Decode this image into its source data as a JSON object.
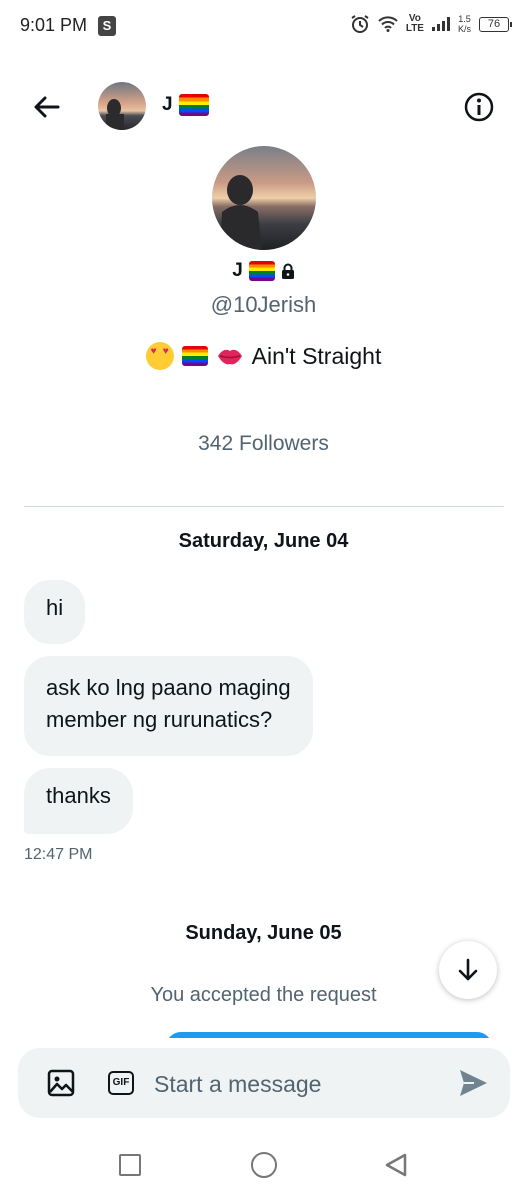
{
  "status_bar": {
    "time": "9:01 PM",
    "shop_badge": "S",
    "volte_top": "Vo",
    "volte_bottom": "LTE",
    "speed_value": "1.5",
    "speed_unit": "K/s",
    "battery": "76"
  },
  "header": {
    "name": "J",
    "icons": [
      "back-arrow-icon",
      "rainbow-flag-icon",
      "info-icon"
    ]
  },
  "profile": {
    "name": "J",
    "handle": "@10Jerish",
    "bio_text": "Ain't Straight",
    "bio_emojis": [
      "heart-eyes",
      "rainbow-flag",
      "kiss-lips"
    ],
    "followers": "342 Followers",
    "protected": true
  },
  "conversation": {
    "day1_label": "Saturday, June 04",
    "messages": [
      {
        "text": "hi"
      },
      {
        "text_line1": "ask ko lng paano maging",
        "text_line2": "member ng rurunatics?"
      },
      {
        "text": "thanks"
      }
    ],
    "timestamp": "12:47 PM",
    "day2_label": "Sunday, June 05",
    "system_message": "You accepted the request"
  },
  "composer": {
    "placeholder": "Start a message",
    "gif_label": "GIF"
  },
  "colors": {
    "accent": "#1d9bf0",
    "bubble_bg": "#eff3f4",
    "secondary_text": "#536471"
  }
}
